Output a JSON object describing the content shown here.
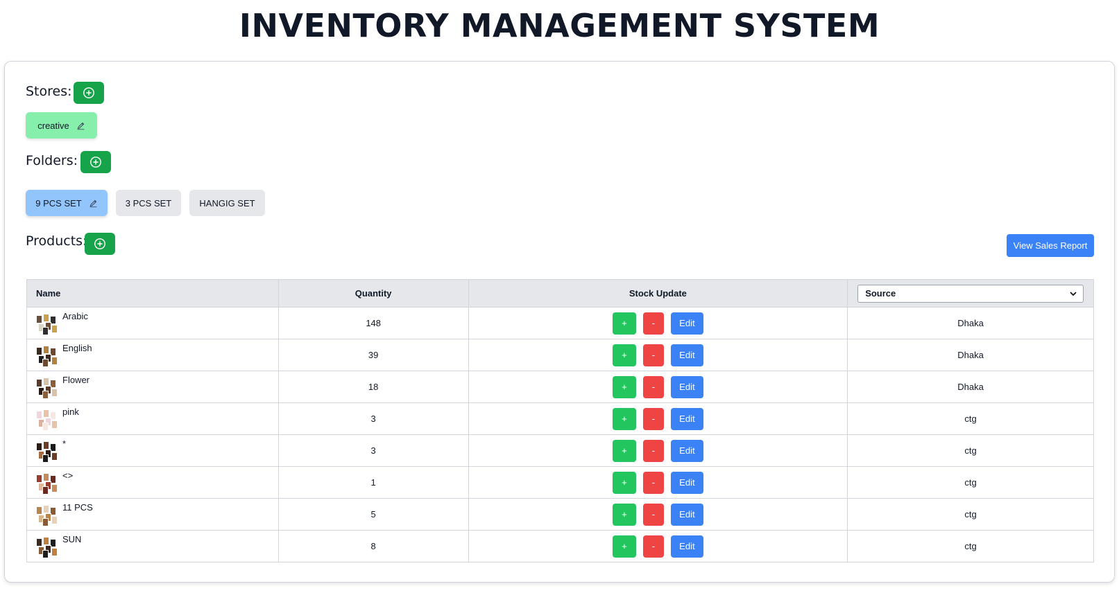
{
  "header": {
    "title": "INVENTORY MANAGEMENT SYSTEM"
  },
  "stores": {
    "label": "Stores:",
    "items": [
      {
        "label": "creative",
        "active": true
      }
    ]
  },
  "folders": {
    "label": "Folders:",
    "items": [
      {
        "label": "9 PCS SET",
        "active": true
      },
      {
        "label": "3 PCS SET",
        "active": false
      },
      {
        "label": "HANGIG SET",
        "active": false
      }
    ]
  },
  "products": {
    "label": "Products:",
    "report_button": "View Sales Report",
    "columns": {
      "name": "Name",
      "quantity": "Quantity",
      "stock_update": "Stock Update",
      "source": "Source"
    },
    "buttons": {
      "plus": "+",
      "minus": "-",
      "edit": "Edit"
    },
    "rows": [
      {
        "name": "Arabic",
        "quantity": "148",
        "source": "Dhaka"
      },
      {
        "name": "English",
        "quantity": "39",
        "source": "Dhaka"
      },
      {
        "name": "Flower",
        "quantity": "18",
        "source": "Dhaka"
      },
      {
        "name": "pink",
        "quantity": "3",
        "source": "ctg"
      },
      {
        "name": "*",
        "quantity": "3",
        "source": "ctg"
      },
      {
        "name": "<>",
        "quantity": "1",
        "source": "ctg"
      },
      {
        "name": "11 PCS",
        "quantity": "5",
        "source": "ctg"
      },
      {
        "name": "SUN",
        "quantity": "8",
        "source": "ctg"
      }
    ]
  },
  "colors": {
    "add_green": "#16a34a",
    "plus_green": "#22c55e",
    "minus_red": "#ef4444",
    "edit_blue": "#3b82f6",
    "store_chip": "#86efac",
    "folder_active": "#93c5fd",
    "folder_inactive": "#e5e7eb"
  }
}
